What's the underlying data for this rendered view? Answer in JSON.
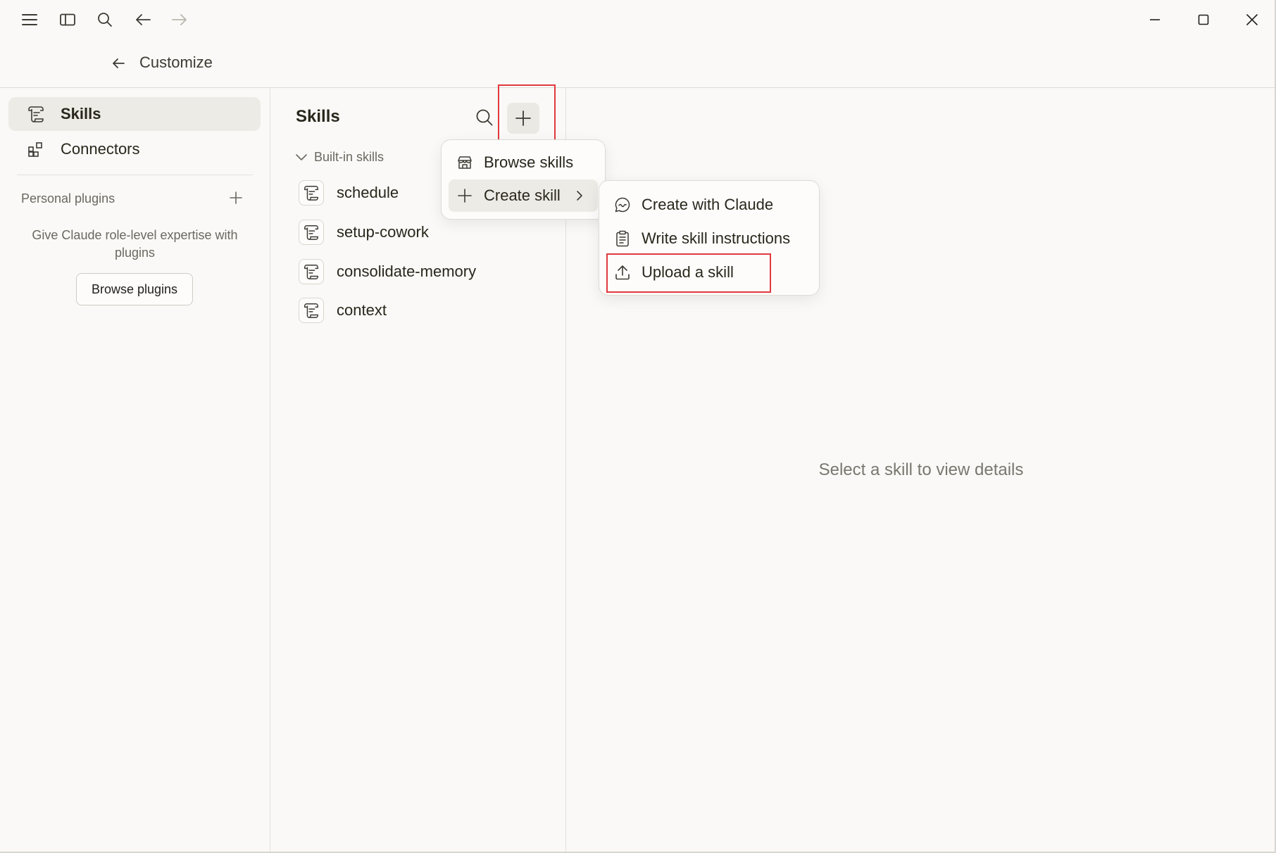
{
  "header": {
    "title": "Customize"
  },
  "sidebar": {
    "items": [
      {
        "label": "Skills",
        "icon": "scroll-icon",
        "active": true
      },
      {
        "label": "Connectors",
        "icon": "grid-plus-icon",
        "active": false
      }
    ],
    "plugins": {
      "title": "Personal plugins",
      "description": "Give Claude role-level expertise with plugins",
      "button": "Browse plugins"
    }
  },
  "skills": {
    "title": "Skills",
    "group": "Built-in skills",
    "items": [
      "schedule",
      "setup-cowork",
      "consolidate-memory",
      "context"
    ]
  },
  "add_menu": {
    "items": [
      {
        "label": "Browse skills",
        "icon": "store-icon"
      },
      {
        "label": "Create skill",
        "icon": "plus-icon",
        "has_submenu": true,
        "active": true
      }
    ]
  },
  "create_submenu": {
    "items": [
      {
        "label": "Create with Claude",
        "icon": "chat-icon"
      },
      {
        "label": "Write skill instructions",
        "icon": "clipboard-icon"
      },
      {
        "label": "Upload a skill",
        "icon": "upload-icon",
        "highlighted": true
      }
    ]
  },
  "detail": {
    "empty_text": "Select a skill to view details"
  },
  "colors": {
    "background": "#faf9f7",
    "highlight": "#e0393e",
    "active_item": "#edebe6"
  }
}
